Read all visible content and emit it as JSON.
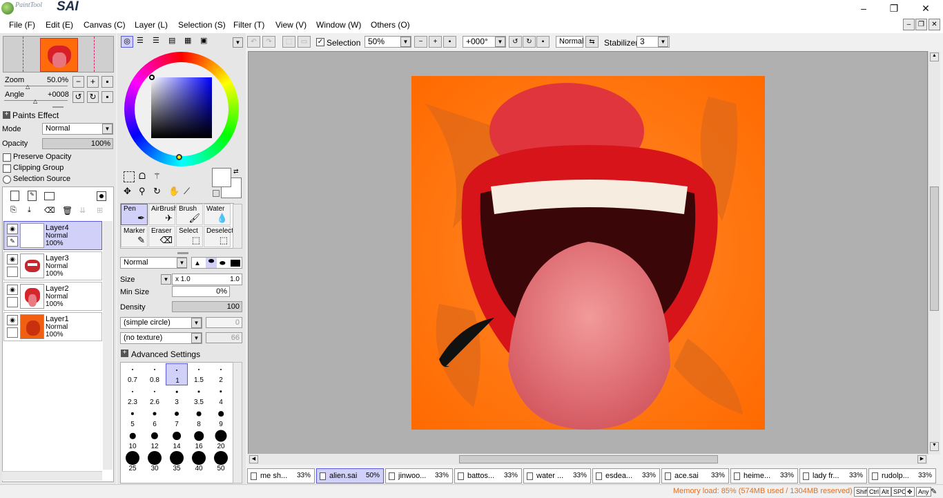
{
  "app": {
    "logo_small": "PaintTool",
    "logo_big": "SAI"
  },
  "window_controls": {
    "minimize": "–",
    "maximize": "❐",
    "close": "✕"
  },
  "menu": [
    "File (F)",
    "Edit (E)",
    "Canvas (C)",
    "Layer (L)",
    "Selection (S)",
    "Filter (T)",
    "View (V)",
    "Window (W)",
    "Others (O)"
  ],
  "navigator": {
    "zoom_label": "Zoom",
    "zoom_value": "50.0%",
    "angle_label": "Angle",
    "angle_value": "+0008"
  },
  "paints_effect": {
    "header": "Paints Effect",
    "mode_label": "Mode",
    "mode_value": "Normal",
    "opacity_label": "Opacity",
    "opacity_value": "100%",
    "preserve_opacity": "Preserve Opacity",
    "clipping_group": "Clipping Group",
    "selection_source": "Selection Source"
  },
  "layers": [
    {
      "name": "Layer4",
      "mode": "Normal",
      "opacity": "100%",
      "active": true
    },
    {
      "name": "Layer3",
      "mode": "Normal",
      "opacity": "100%",
      "active": false
    },
    {
      "name": "Layer2",
      "mode": "Normal",
      "opacity": "100%",
      "active": false
    },
    {
      "name": "Layer1",
      "mode": "Normal",
      "opacity": "100%",
      "active": false
    }
  ],
  "tools": [
    {
      "label": "Pen",
      "active": true
    },
    {
      "label": "AirBrush",
      "active": false
    },
    {
      "label": "Brush",
      "active": false
    },
    {
      "label": "Water",
      "active": false
    },
    {
      "label": "Marker",
      "active": false
    },
    {
      "label": "Eraser",
      "active": false
    },
    {
      "label": "Select",
      "active": false
    },
    {
      "label": "Deselect",
      "active": false
    }
  ],
  "tool_settings": {
    "blend_mode": "Normal",
    "size_label": "Size",
    "size_multiplier": "x 1.0",
    "size_value": "1.0",
    "min_size_label": "Min Size",
    "min_size_value": "0%",
    "density_label": "Density",
    "density_value": "100",
    "shape": "(simple circle)",
    "shape_value": "0",
    "texture": "(no texture)",
    "texture_value": "66",
    "advanced_settings": "Advanced Settings"
  },
  "brush_sizes": [
    "0.7",
    "0.8",
    "1",
    "1.5",
    "2",
    "2.3",
    "2.6",
    "3",
    "3.5",
    "4",
    "5",
    "6",
    "7",
    "8",
    "9",
    "10",
    "12",
    "14",
    "16",
    "20",
    "25",
    "30",
    "35",
    "40",
    "50"
  ],
  "toolbar": {
    "selection_label": "Selection",
    "zoom": "50%",
    "angle": "+000°",
    "blend": "Normal",
    "stabilizer_label": "Stabilizer",
    "stabilizer_value": "3"
  },
  "tabs": [
    {
      "name": "me sh...",
      "pct": "33%",
      "active": false
    },
    {
      "name": "alien.sai",
      "pct": "50%",
      "active": true
    },
    {
      "name": "jinwoo...",
      "pct": "33%",
      "active": false
    },
    {
      "name": "battos...",
      "pct": "33%",
      "active": false
    },
    {
      "name": "water ...",
      "pct": "33%",
      "active": false
    },
    {
      "name": "esdea...",
      "pct": "33%",
      "active": false
    },
    {
      "name": "ace.sai",
      "pct": "33%",
      "active": false
    },
    {
      "name": "heime...",
      "pct": "33%",
      "active": false
    },
    {
      "name": "lady fr...",
      "pct": "33%",
      "active": false
    },
    {
      "name": "rudolp...",
      "pct": "33%",
      "active": false
    }
  ],
  "status": {
    "memory": "Memory load: 85% (574MB used / 1304MB reserved)",
    "keys": [
      "Shift",
      "Ctrl",
      "Alt",
      "SPC",
      "Any"
    ]
  },
  "colors": {
    "accent_selected": "#d0d0f8",
    "accent_border": "#5a5ae0",
    "canvas_bg": "#ff6e0a",
    "status_text": "#e07020"
  }
}
